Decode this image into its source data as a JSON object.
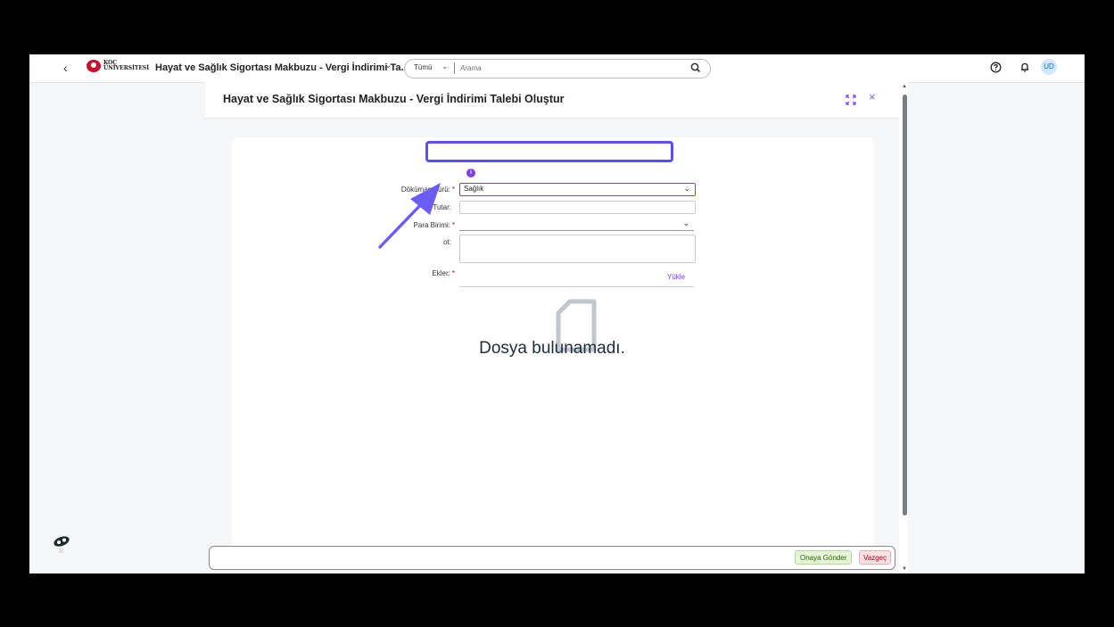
{
  "shell": {
    "back": "‹",
    "logo_line1": "KOÇ",
    "logo_line2": "ÜNİVERSİTESİ",
    "app_title": "Hayat ve Sağlık Sigortası Makbuzu - Vergi İndirimi Ta...",
    "search_scope": "Tümü",
    "search_placeholder": "Arama",
    "avatar": "UD"
  },
  "dialog": {
    "title": "Hayat ve Sağlık Sigortası Makbuzu - Vergi İndirimi Talebi Oluştur",
    "close": "×"
  },
  "form": {
    "info": "i",
    "doc_type_label": "Döküman Türü:",
    "doc_type_value": "Sağlık",
    "amount_label": "Tutar:",
    "amount_value": "",
    "currency_label": "Para Birimi:",
    "currency_value": "",
    "note_label": "ot:",
    "attachments_label": "Ekler:",
    "upload_label": "Yükle",
    "req_mark": "*",
    "empty_text": "Dosya bulunamadı."
  },
  "footer": {
    "send": "Onaya Gönder",
    "cancel": "Vazgeç"
  },
  "colors": {
    "accent": "#7a3ef0",
    "highlight": "#5b4ef7"
  }
}
